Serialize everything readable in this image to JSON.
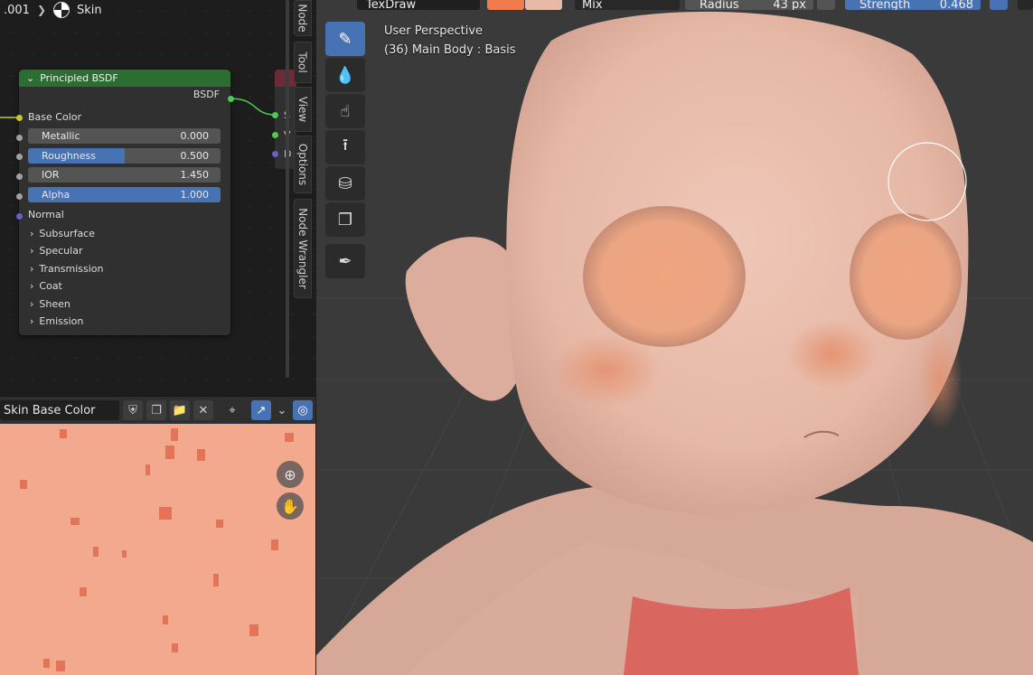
{
  "node_editor": {
    "breadcrumb": {
      "prev": ".001",
      "material": "Skin"
    },
    "principled_node": {
      "title": "Principled BSDF",
      "output": "BSDF",
      "base_color": "Base Color",
      "fields": [
        {
          "label": "Metallic",
          "value": "0.000",
          "fill": 0.0
        },
        {
          "label": "Roughness",
          "value": "0.500",
          "fill": 0.5
        },
        {
          "label": "IOR",
          "value": "1.450",
          "fill": 0.0
        },
        {
          "label": "Alpha",
          "value": "1.000",
          "fill": 1.0
        }
      ],
      "normal": "Normal",
      "panels": [
        "Subsurface",
        "Specular",
        "Transmission",
        "Coat",
        "Sheen",
        "Emission"
      ]
    },
    "output_node": {
      "labels": [
        "S",
        "V",
        "D"
      ]
    },
    "side_tabs": [
      "Node",
      "Tool",
      "View",
      "Options",
      "Node Wrangler"
    ]
  },
  "image_editor": {
    "image_name": "Skin Base Color"
  },
  "viewport": {
    "perspective": "User Perspective",
    "object_info": "(36) Main Body : Basis",
    "header": {
      "brush": "TexDraw",
      "blend": "Mix",
      "radius_label": "Radius",
      "radius_value": "43 px",
      "strength_label": "Strength",
      "strength_value": "0.468"
    },
    "tools": [
      "draw-brush",
      "soften-brush",
      "smear-brush",
      "clone-brush",
      "fill-brush",
      "mask-brush",
      "annotate-tool"
    ]
  },
  "colors": {
    "accent": "#4772b3",
    "node_header": "#2c6e31",
    "skin": "#e8b8a6",
    "texture": "#f2a98e",
    "fg_color": "#f07b4e",
    "bg_color": "#e7b9a7"
  }
}
